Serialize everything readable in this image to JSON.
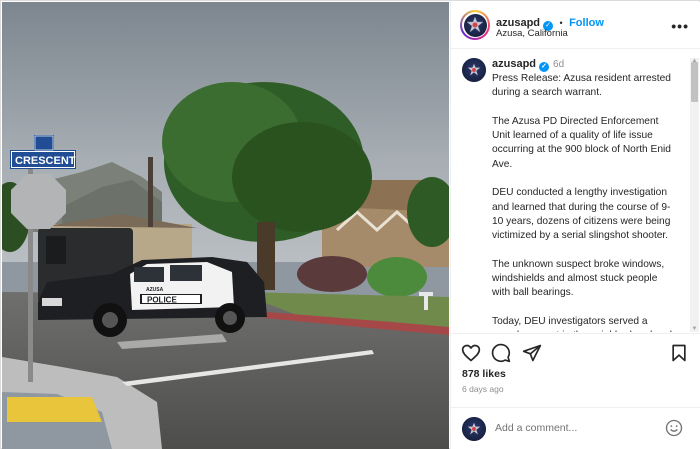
{
  "header": {
    "username": "azusapd",
    "follow_label": "Follow",
    "separator": "•",
    "location": "Azusa, California",
    "more_label": "•••"
  },
  "caption": {
    "username": "azusapd",
    "time_ago": "6d",
    "text": "Press Release: Azusa resident arrested during a search warrant.\n\nThe Azusa PD Directed Enforcement Unit learned of a quality of life issue occurring at the 900 block of North Enid Ave.\n\nDEU conducted a lengthy investigation and learned that during the course of 9-10 years, dozens of citizens were being victimized by a serial slingshot shooter.\n\nThe unknown suspect broke windows, windshields and almost stuck people with ball bearings.\n\nToday, DEU investigators served a search warrant in the neighborhood and"
  },
  "photo": {
    "street_sign": "CRESCENT",
    "street_sign_small": "700\nW",
    "vehicle_text": "POLICE",
    "vehicle_city": "AZUSA"
  },
  "engagement": {
    "likes": "878 likes",
    "date": "6 days ago"
  },
  "comment": {
    "placeholder": "Add a comment..."
  },
  "colors": {
    "accent": "#0095f6",
    "secondary_text": "#8e8e8e"
  }
}
